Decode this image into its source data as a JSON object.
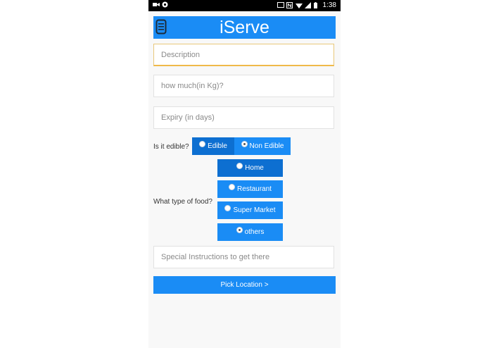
{
  "statusbar": {
    "time": "1:38"
  },
  "app": {
    "title": "iServe"
  },
  "form": {
    "description_placeholder": "Description",
    "quantity_placeholder": "how much(in Kg)?",
    "expiry_placeholder": "Expiry (in days)",
    "edible_question": "Is it edible?",
    "edible_options": [
      {
        "label": "Edible",
        "selected": false
      },
      {
        "label": "Non Edible",
        "selected": true
      }
    ],
    "food_type_question": "What type of food?",
    "food_type_options": [
      {
        "label": "Home",
        "selected": false
      },
      {
        "label": "Restaurant",
        "selected": false
      },
      {
        "label": "Super Market",
        "selected": false
      },
      {
        "label": "others",
        "selected": true
      }
    ],
    "instructions_placeholder": "Special Instructions to get there",
    "pick_location_label": "Pick Location >"
  },
  "colors": {
    "accent": "#1a8cf5",
    "accent_dark": "#0d6fd1",
    "focus_border": "#f0b94a"
  }
}
